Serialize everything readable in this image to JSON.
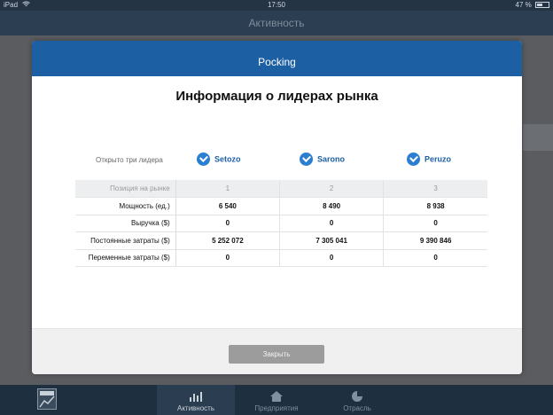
{
  "status_bar": {
    "device": "iPad",
    "time": "17:50",
    "battery": "47 %"
  },
  "nav": {
    "title": "Активность"
  },
  "modal": {
    "header": "Pocking",
    "title": "Информация о лидерах рынка",
    "leaders_label": "Открыто три лидера",
    "leaders": [
      "Setozo",
      "Sarono",
      "Peruzo"
    ],
    "table": {
      "header_label": "Позиция на рынке",
      "positions": [
        "1",
        "2",
        "3"
      ],
      "rows": [
        {
          "label": "Мощность (ед.)",
          "values": [
            "6 540",
            "8 490",
            "8 938"
          ]
        },
        {
          "label": "Выручка ($)",
          "values": [
            "0",
            "0",
            "0"
          ]
        },
        {
          "label": "Постоянные затраты ($)",
          "values": [
            "5 252 072",
            "7 305 041",
            "9 390 846"
          ]
        },
        {
          "label": "Переменные затраты ($)",
          "values": [
            "0",
            "0",
            "0"
          ]
        }
      ]
    },
    "close_label": "Закрыть"
  },
  "tabbar": {
    "tabs": [
      {
        "label": "Активность",
        "icon": "bar-chart-icon"
      },
      {
        "label": "Предприятия",
        "icon": "house-icon"
      },
      {
        "label": "Отрасль",
        "icon": "pie-chart-icon"
      }
    ]
  },
  "colors": {
    "accent": "#1d5fa3",
    "check": "#2c7fd0",
    "button": "#9c9c9c"
  }
}
